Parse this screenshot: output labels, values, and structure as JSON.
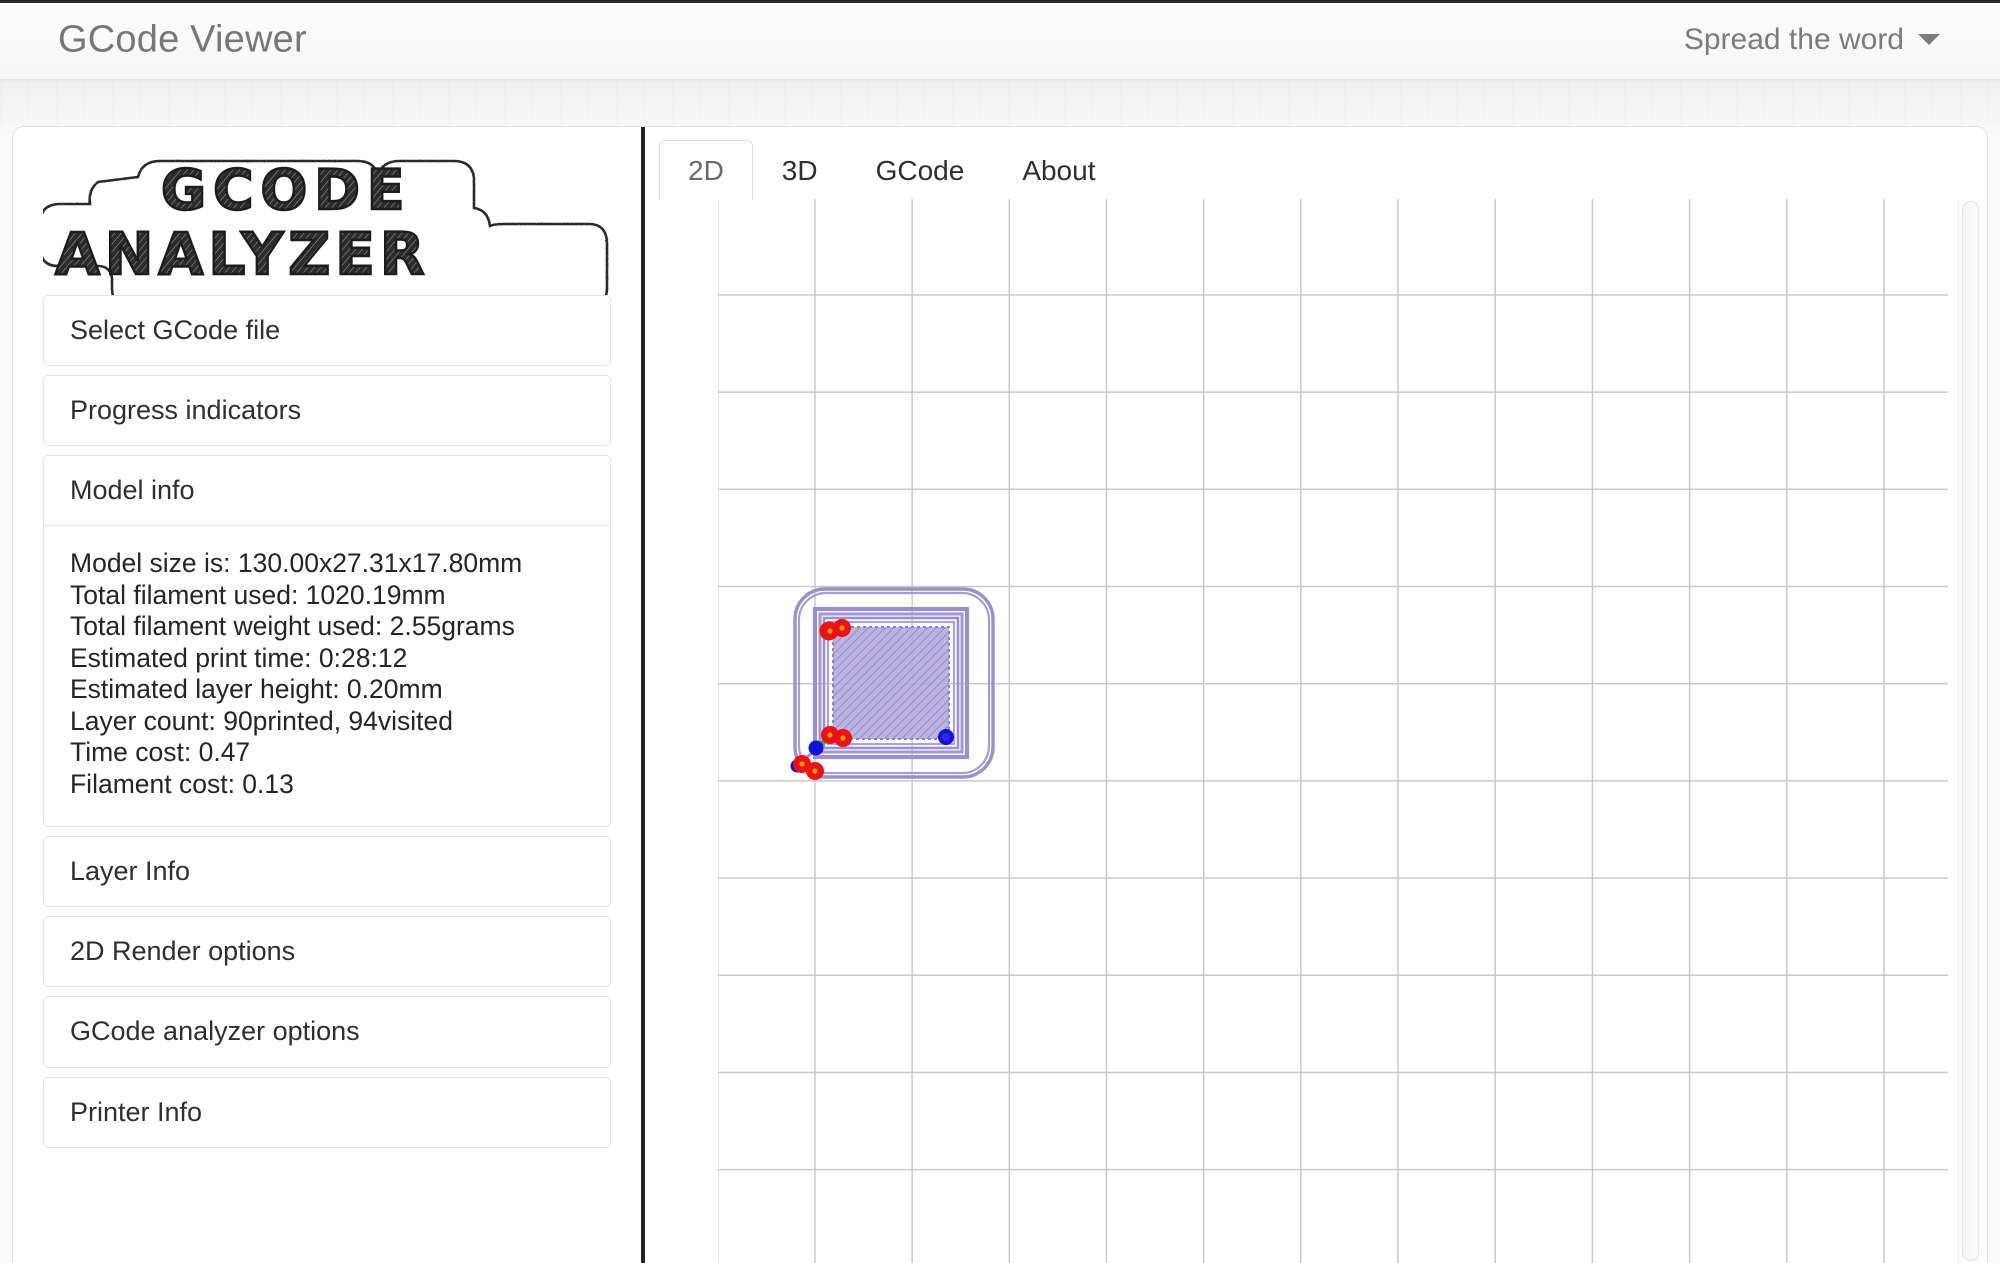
{
  "navbar": {
    "brand": "GCode Viewer",
    "spread_label": "Spread the word",
    "caret_icon": "chevron-down-icon"
  },
  "sidebar": {
    "logo_text_line1": "GCODE",
    "logo_text_line2": "ANALYZER",
    "panels": [
      {
        "label": "Select GCode file"
      },
      {
        "label": "Progress indicators"
      },
      {
        "label": "Model info"
      },
      {
        "label": "Layer Info"
      },
      {
        "label": "2D Render options"
      },
      {
        "label": "GCode analyzer options"
      },
      {
        "label": "Printer Info"
      }
    ],
    "model_info": {
      "title": "Model info",
      "lines": [
        "Model size is: 130.00x27.31x17.80mm",
        "Total filament used: 1020.19mm",
        "Total filament weight used: 2.55grams",
        "Estimated print time: 0:28:12",
        "Estimated layer height: 0.20mm",
        "Layer count: 90printed, 94visited",
        "Time cost: 0.47",
        "Filament cost: 0.13"
      ]
    }
  },
  "main": {
    "tabs": [
      {
        "label": "2D",
        "active": true
      },
      {
        "label": "3D",
        "active": false
      },
      {
        "label": "GCode",
        "active": false
      },
      {
        "label": "About",
        "active": false
      }
    ],
    "viewport": {
      "grid_color": "#c9c9c9",
      "grid_spacing_px": 97,
      "background": "#ffffff"
    },
    "render": {
      "extrusion_color": "#9b8fd1",
      "retract_marker_color": "#ee1111",
      "retract_marker_core_color": "#d8a000",
      "restart_marker_color": "#1111dd",
      "travel_marker_color": "#22bb22"
    }
  }
}
